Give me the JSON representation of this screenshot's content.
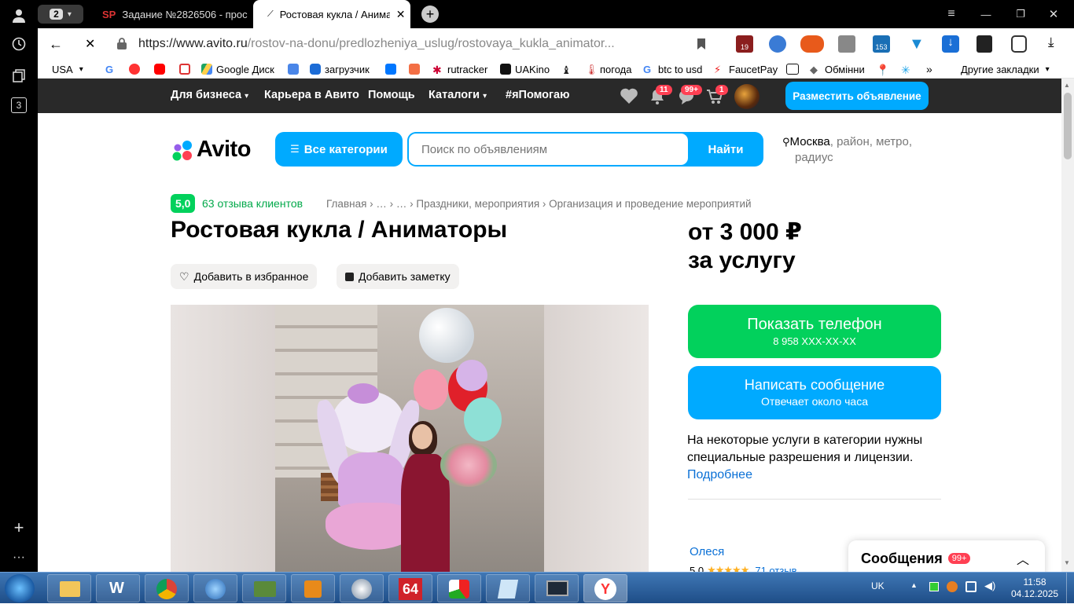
{
  "browser": {
    "rail_tab_count": "3",
    "tab_group_count": "2",
    "tabs": [
      {
        "title": "Задание №2826506 - прос",
        "favicon": "SP"
      },
      {
        "title": "Ростовая кукла / Аниматоры"
      }
    ],
    "url_host": "https://www.avito.ru",
    "url_path": "/rostov-na-donu/predlozheniya_uslug/rostovaya_kukla_animator...",
    "ext_badge_1": "19",
    "ext_badge_2": "153",
    "bookmarks": [
      "USA",
      "Google Диск",
      "загрузчик",
      "rutracker",
      "UAKino",
      "погода",
      "btc to usd",
      "FaucetPay",
      "Обмінни"
    ],
    "other_bookmarks": "Другие закладки",
    "more": "»"
  },
  "avito_nav": {
    "items": [
      "Для бизнеса",
      "Карьера в Авито",
      "Помощь",
      "Каталоги",
      "#яПомогаю"
    ],
    "notif_badge": "11",
    "messages_badge": "99+",
    "cart_badge": "1",
    "post_ad": "Разместить объявление"
  },
  "header": {
    "logo": "Avito",
    "all_categories": "Все категории",
    "search_placeholder": "Поиск по объявлениям",
    "search_button": "Найти",
    "location_city": "Москва",
    "location_rest_1": ", район, метро,",
    "location_rest_2": "радиус"
  },
  "listing": {
    "rating": "5,0",
    "reviews": "63 отзыва клиентов",
    "breadcrumb": "Главная › … › … › Праздники, мероприятия › Организация и проведение мероприятий",
    "title": "Ростовая кукла / Аниматоры",
    "add_fav": "Добавить в избранное",
    "add_note": "Добавить заметку",
    "price_line1": "от 3 000 ₽",
    "price_line2": "за услугу",
    "show_phone": "Показать телефон",
    "phone_masked": "8 958 XXX-XX-XX",
    "write_message": "Написать сообщение",
    "reply_time": "Отвечает около часа",
    "license_note": "На некоторые услуги в категории нужны специальные разрешения и лицензии.",
    "more_link": "Подробнее",
    "seller_name": "Олеся",
    "seller_rating": "5,0",
    "seller_reviews": "71 отзыв"
  },
  "messages_widget": {
    "label": "Сообщения",
    "badge": "99+"
  },
  "taskbar": {
    "lang": "UK",
    "time": "11:58",
    "date": "04.12.2025",
    "app_64": "64"
  },
  "colors": {
    "avito_blue": "#00aaff",
    "avito_green": "#02d15c",
    "link_blue": "#0a70d6",
    "nav_dark": "#292929"
  }
}
